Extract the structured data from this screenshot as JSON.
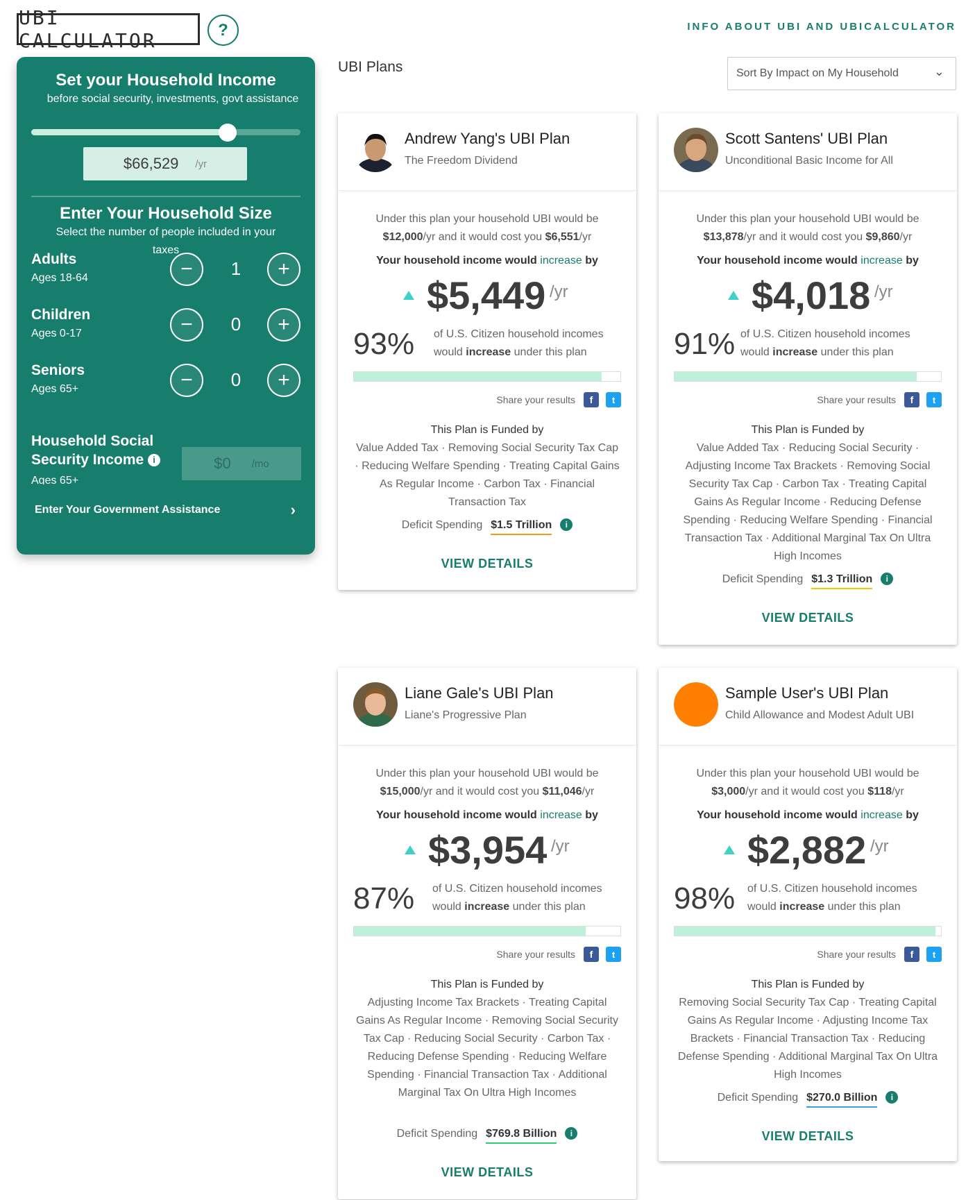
{
  "header": {
    "logo_text": "UBI CALCULATOR",
    "help_label": "?",
    "info_link": "INFO ABOUT UBI AND UBICALCULATOR"
  },
  "sidebar": {
    "income_title": "Set your Household Income",
    "income_subtitle": "before social security, investments, govt assistance",
    "income_value": "$66,529",
    "income_unit": "/yr",
    "slider_fraction": 0.73,
    "size_title": "Enter Your Household Size",
    "size_subtitle": "Select the number of people included in your taxes",
    "rows": [
      {
        "label": "Adults",
        "age": "Ages 18-64",
        "count": "1"
      },
      {
        "label": "Children",
        "age": "Ages 0-17",
        "count": "0"
      },
      {
        "label": "Seniors",
        "age": "Ages 65+",
        "count": "0"
      }
    ],
    "minus_label": "−",
    "plus_label": "+",
    "ss_label": "Household Social Security Income",
    "ss_info": "i",
    "ss_age": "Ages 65+",
    "ss_value": "$0",
    "ss_unit": "/mo",
    "gov_label": "Enter Your Government Assistance",
    "gov_chevron": "›"
  },
  "main": {
    "title": "UBI Plans",
    "sort_value": "Sort By Impact on My Household",
    "sort_chevron": "⌄"
  },
  "colors": {
    "brand": "#177d6c",
    "accent": "#3ed1c6",
    "bar": "#bff0dc"
  },
  "cards": [
    {
      "name": "Andrew Yang's UBI Plan",
      "subtitle": "The Freedom Dividend",
      "avatar": "andrew-yang-photo",
      "cost_pre": "Under this plan your household UBI would be",
      "ubi": "$12,000",
      "cost_mid": "/yr and it would cost you",
      "cost": "$6,551",
      "cost_post": "/yr",
      "increase_pre": "Your household income would",
      "increase_word": "increase",
      "increase_post": "by",
      "amount": "$5,449",
      "amount_unit": "/yr",
      "pct": "93%",
      "pct_fraction": 0.93,
      "pct_text_pre": "of U.S. Citizen household incomes would",
      "pct_text_bold": "increase",
      "pct_text_post": "under this plan",
      "share": "Share your results",
      "funded_title": "This Plan is Funded by",
      "funded": "Value Added Tax · Removing Social Security Tax Cap · Reducing Welfare Spending · Treating Capital Gains As Regular Income · Carbon Tax · Financial Transaction Tax",
      "deficit_label": "Deficit Spending",
      "deficit": "$1.5 Trillion",
      "deficit_color": "#f39c12",
      "view": "VIEW DETAILS"
    },
    {
      "name": "Scott Santens' UBI Plan",
      "subtitle": "Unconditional Basic Income for All",
      "avatar": "scott-santens-photo",
      "cost_pre": "Under this plan your household UBI would be",
      "ubi": "$13,878",
      "cost_mid": "/yr and it would cost you",
      "cost": "$9,860",
      "cost_post": "/yr",
      "increase_pre": "Your household income would",
      "increase_word": "increase",
      "increase_post": "by",
      "amount": "$4,018",
      "amount_unit": "/yr",
      "pct": "91%",
      "pct_fraction": 0.91,
      "pct_text_pre": "of U.S. Citizen household incomes would",
      "pct_text_bold": "increase",
      "pct_text_post": "under this plan",
      "share": "Share your results",
      "funded_title": "This Plan is Funded by",
      "funded": "Value Added Tax · Reducing Social Security · Adjusting Income Tax Brackets · Removing Social Security Tax Cap · Carbon Tax · Treating Capital Gains As Regular Income · Reducing Defense Spending · Reducing Welfare Spending · Financial Transaction Tax · Additional Marginal Tax On Ultra High Incomes",
      "deficit_label": "Deficit Spending",
      "deficit": "$1.3 Trillion",
      "deficit_color": "#f1c40f",
      "view": "VIEW DETAILS"
    },
    {
      "name": "Liane Gale's UBI Plan",
      "subtitle": "Liane's Progressive Plan",
      "avatar": "liane-gale-photo",
      "cost_pre": "Under this plan your household UBI would be",
      "ubi": "$15,000",
      "cost_mid": "/yr and it would cost you",
      "cost": "$11,046",
      "cost_post": "/yr",
      "increase_pre": "Your household income would",
      "increase_word": "increase",
      "increase_post": "by",
      "amount": "$3,954",
      "amount_unit": "/yr",
      "pct": "87%",
      "pct_fraction": 0.87,
      "pct_text_pre": "of U.S. Citizen household incomes would",
      "pct_text_bold": "increase",
      "pct_text_post": "under this plan",
      "share": "Share your results",
      "funded_title": "This Plan is Funded by",
      "funded": "Adjusting Income Tax Brackets · Treating Capital Gains As Regular Income · Removing Social Security Tax Cap · Reducing Social Security · Carbon Tax · Reducing Defense Spending · Reducing Welfare Spending · Financial Transaction Tax · Additional Marginal Tax On Ultra High Incomes",
      "deficit_label": "Deficit Spending",
      "deficit": "$769.8 Billion",
      "deficit_color": "#2ecc71",
      "view": "VIEW DETAILS"
    },
    {
      "name": "Sample User's UBI Plan",
      "subtitle": "Child Allowance and Modest Adult UBI",
      "avatar": "orange-circle-avatar",
      "cost_pre": "Under this plan your household UBI would be",
      "ubi": "$3,000",
      "cost_mid": "/yr and it would cost you",
      "cost": "$118",
      "cost_post": "/yr",
      "increase_pre": "Your household income would",
      "increase_word": "increase",
      "increase_post": "by",
      "amount": "$2,882",
      "amount_unit": "/yr",
      "pct": "98%",
      "pct_fraction": 0.98,
      "pct_text_pre": "of U.S. Citizen household incomes would",
      "pct_text_bold": "increase",
      "pct_text_post": "under this plan",
      "share": "Share your results",
      "funded_title": "This Plan is Funded by",
      "funded": "Removing Social Security Tax Cap · Treating Capital Gains As Regular Income · Adjusting Income Tax Brackets · Financial Transaction Tax · Reducing Defense Spending · Additional Marginal Tax On Ultra High Incomes",
      "deficit_label": "Deficit Spending",
      "deficit": "$270.0 Billion",
      "deficit_color": "#3aa0d8",
      "view": "VIEW DETAILS"
    }
  ]
}
